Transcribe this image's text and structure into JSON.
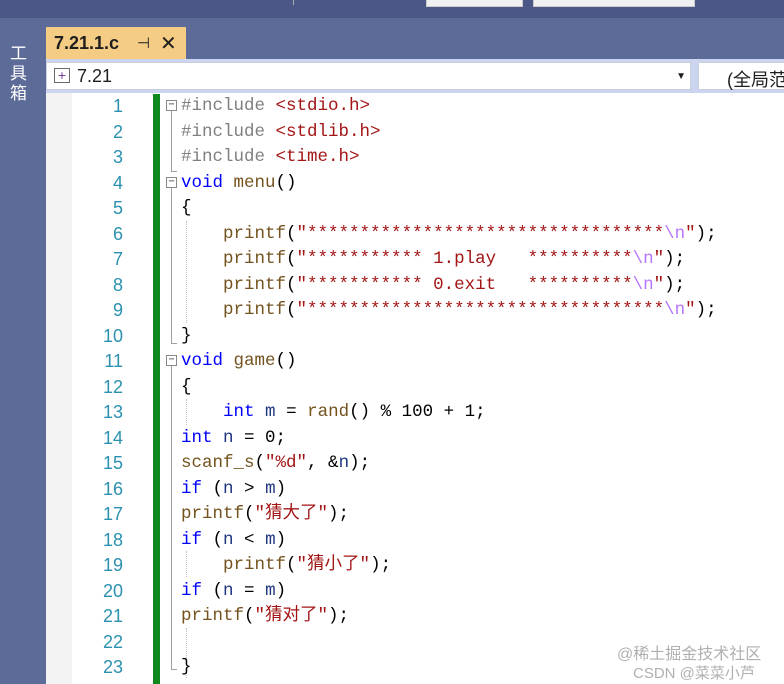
{
  "toolbox": {
    "label": "工具箱"
  },
  "tab": {
    "title": "7.21.1.c",
    "pin_glyph": "⊣",
    "close_glyph": "✕"
  },
  "navbar": {
    "project": "7.21",
    "scope": "(全局范"
  },
  "editor": {
    "lines": [
      {
        "n": "1",
        "html": "<span class='pp'>#include</span> <span class='inc'>&lt;stdio.h&gt;</span>"
      },
      {
        "n": "2",
        "html": "<span class='pp'>#include</span> <span class='inc'>&lt;stdlib.h&gt;</span>"
      },
      {
        "n": "3",
        "html": "<span class='pp'>#include</span> <span class='inc'>&lt;time.h&gt;</span>"
      },
      {
        "n": "4",
        "html": "<span class='kw'>void</span> <span class='fn'>menu</span>()"
      },
      {
        "n": "5",
        "html": "{"
      },
      {
        "n": "6",
        "html": "    <span class='fn'>printf</span>(<span class='str'>\"**********************************</span><span class='esc'>\\n</span><span class='str'>\"</span>);"
      },
      {
        "n": "7",
        "html": "    <span class='fn'>printf</span>(<span class='str'>\"*********** 1.play   **********</span><span class='esc'>\\n</span><span class='str'>\"</span>);"
      },
      {
        "n": "8",
        "html": "    <span class='fn'>printf</span>(<span class='str'>\"*********** 0.exit   **********</span><span class='esc'>\\n</span><span class='str'>\"</span>);"
      },
      {
        "n": "9",
        "html": "    <span class='fn'>printf</span>(<span class='str'>\"**********************************</span><span class='esc'>\\n</span><span class='str'>\"</span>);"
      },
      {
        "n": "10",
        "html": "}"
      },
      {
        "n": "11",
        "html": "<span class='kw'>void</span> <span class='fn'>game</span>()"
      },
      {
        "n": "12",
        "html": "{"
      },
      {
        "n": "13",
        "html": "    <span class='kw'>int</span> <span class='var'>m</span> = <span class='fn'>rand</span>() % 100 + 1;"
      },
      {
        "n": "14",
        "html": "<span class='kw'>int</span> <span class='var'>n</span> = 0;"
      },
      {
        "n": "15",
        "html": "<span class='fn'>scanf_s</span>(<span class='str'>\"%d\"</span>, &amp;<span class='var'>n</span>);"
      },
      {
        "n": "16",
        "html": "<span class='kw'>if</span> (<span class='var'>n</span> &gt; <span class='var'>m</span>)"
      },
      {
        "n": "17",
        "html": "<span class='fn'>printf</span>(<span class='str'>\"猜大了\"</span>);"
      },
      {
        "n": "18",
        "html": "<span class='kw'>if</span> (<span class='var'>n</span> &lt; <span class='var'>m</span>)"
      },
      {
        "n": "19",
        "html": "    <span class='fn'>printf</span>(<span class='str'>\"猜小了\"</span>);"
      },
      {
        "n": "20",
        "html": "<span class='kw'>if</span> (<span class='var'>n</span> = <span class='var'>m</span>)"
      },
      {
        "n": "21",
        "html": "<span class='fn'>printf</span>(<span class='str'>\"猜对了\"</span>);"
      },
      {
        "n": "22",
        "html": ""
      },
      {
        "n": "23",
        "html": "}"
      }
    ]
  },
  "watermark": {
    "line1": "@稀土掘金技术社区",
    "line2": "CSDN @菜菜小芦"
  }
}
